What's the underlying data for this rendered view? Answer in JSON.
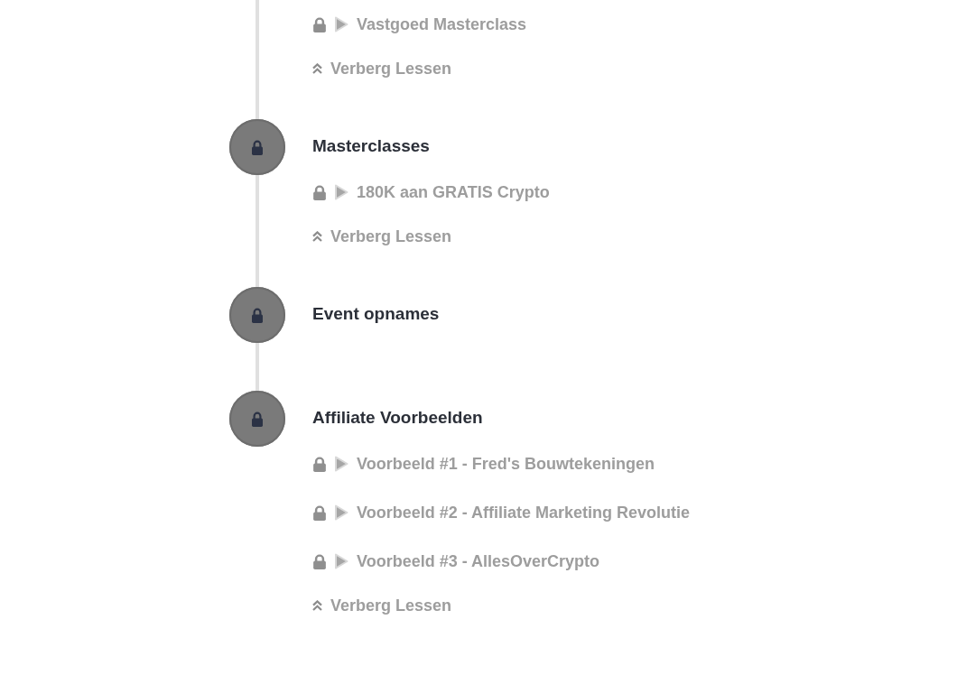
{
  "sections": [
    {
      "lessons": [
        {
          "title": "Vastgoed Masterclass",
          "locked": true
        }
      ],
      "toggle": "Verberg Lessen",
      "expanded": true
    },
    {
      "title": "Masterclasses",
      "locked": true,
      "lessons": [
        {
          "title": "180K aan GRATIS Crypto",
          "locked": true
        }
      ],
      "toggle": "Verberg Lessen",
      "expanded": true
    },
    {
      "title": "Event opnames",
      "locked": true
    },
    {
      "title": "Affiliate Voorbeelden",
      "locked": true,
      "lessons": [
        {
          "title": "Voorbeeld #1 - Fred's Bouwtekeningen",
          "locked": true
        },
        {
          "title": "Voorbeeld #2 - Affiliate Marketing Revolutie",
          "locked": true
        },
        {
          "title": "Voorbeeld #3 - AllesOverCrypto",
          "locked": true
        }
      ],
      "toggle": "Verberg Lessen",
      "expanded": true
    }
  ]
}
